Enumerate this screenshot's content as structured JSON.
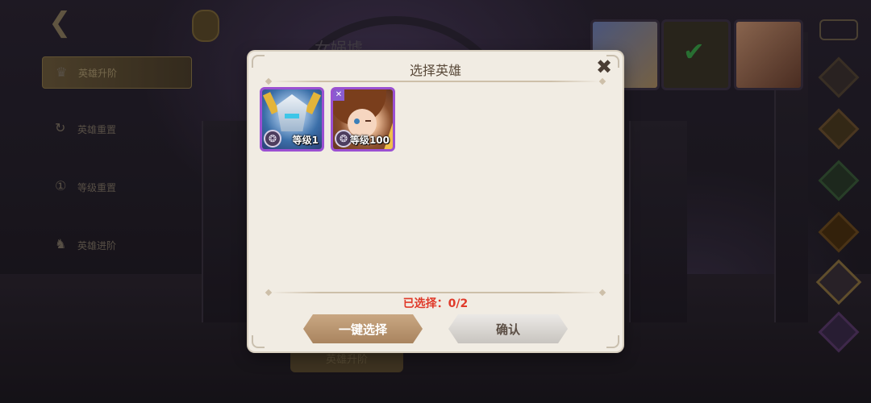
{
  "background": {
    "faded_title": "女娲墟",
    "sidebar": [
      {
        "label": "英雄升阶",
        "icon": "crown-icon",
        "active": true
      },
      {
        "label": "英雄重置",
        "icon": "reset-icon",
        "active": false
      },
      {
        "label": "等级重置",
        "icon": "level-icon",
        "active": false
      },
      {
        "label": "英雄进阶",
        "icon": "horse-icon",
        "active": false
      }
    ],
    "bottom_button": "英雄升阶"
  },
  "modal": {
    "title": "选择英雄",
    "close_icon": "close-icon",
    "heroes": [
      {
        "level_text": "等级1",
        "frame_color": "#9b50d2",
        "faction_icon": "faction-icon"
      },
      {
        "level_text": "等级100",
        "frame_color": "#9b50d2",
        "faction_icon": "faction-icon",
        "class_badge": "✕"
      }
    ],
    "selected_status": "已选择：0/2",
    "buttons": {
      "auto_select": "一键选择",
      "confirm": "确认"
    }
  },
  "colors": {
    "accent_red": "#e03a2a",
    "frame_purple": "#9b50d2",
    "panel_bg": "#f1ece3"
  }
}
